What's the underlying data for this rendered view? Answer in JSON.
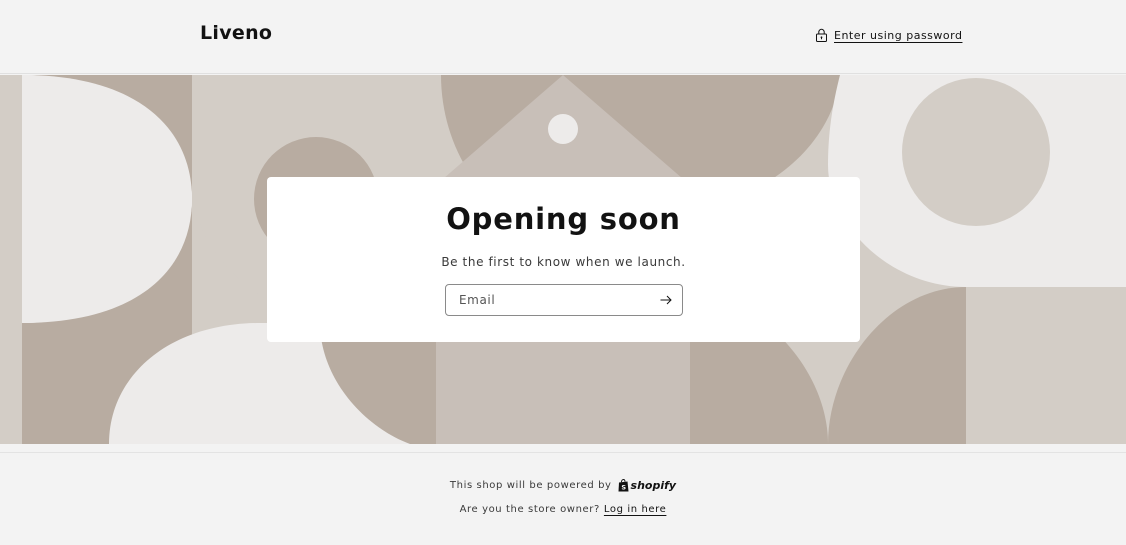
{
  "header": {
    "logo": "Liveno",
    "password_link": "Enter using password",
    "password_icon": "lock-icon"
  },
  "card": {
    "title": "Opening soon",
    "subtitle": "Be the first to know when we launch.",
    "email_placeholder": "Email",
    "submit_icon": "arrow-right-icon"
  },
  "footer": {
    "powered_text": "This shop will be powered by",
    "shopify_word": "shopify",
    "owner_text": "Are you the store owner?",
    "login_link": "Log in here"
  },
  "colors": {
    "background": "#f3f3f3",
    "banner_dark": "#b8aca1",
    "banner_mid": "#d3cdc6",
    "banner_light": "#edebea",
    "banner_taupe": "#c8bfb8",
    "text": "#121212"
  }
}
